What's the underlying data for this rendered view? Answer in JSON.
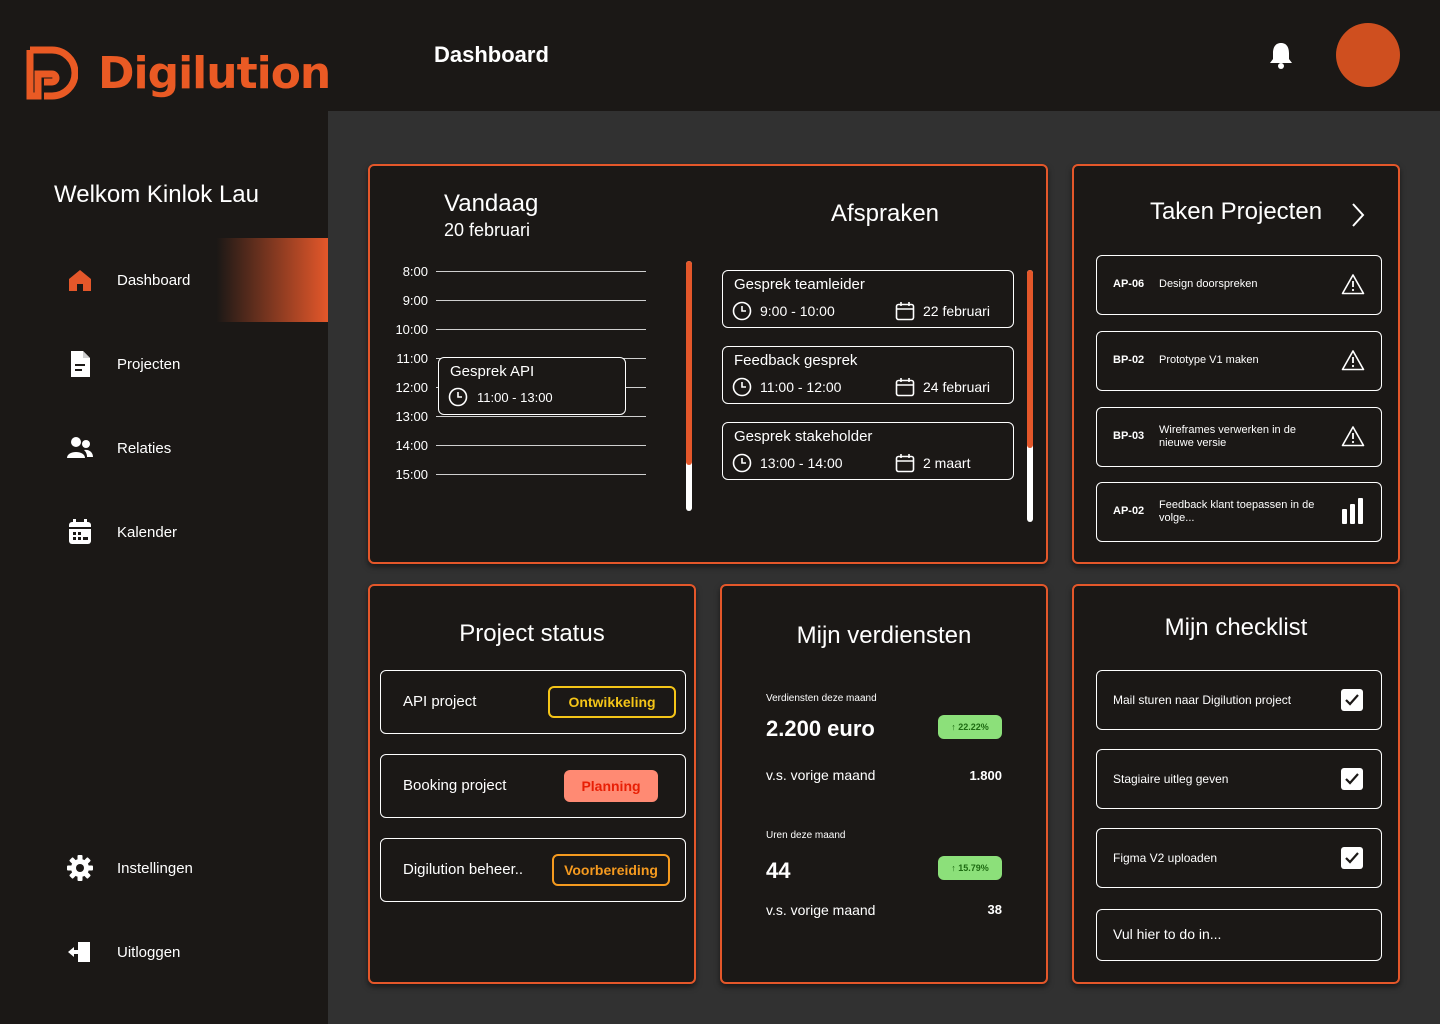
{
  "brand": {
    "name": "Digilution",
    "accent": "#e4572a",
    "logo_icon": "digilution-logo-icon"
  },
  "header": {
    "title": "Dashboard",
    "bell_icon": "bell-icon"
  },
  "sidebar": {
    "welcome": "Welkom Kinlok Lau",
    "items": [
      {
        "label": "Dashboard",
        "icon": "home-icon",
        "active": true
      },
      {
        "label": "Projecten",
        "icon": "document-icon"
      },
      {
        "label": "Relaties",
        "icon": "users-icon"
      },
      {
        "label": "Kalender",
        "icon": "calendar-icon"
      }
    ],
    "bottom": [
      {
        "label": "Instellingen",
        "icon": "gear-icon"
      },
      {
        "label": "Uitloggen",
        "icon": "logout-icon"
      }
    ]
  },
  "today": {
    "title": "Vandaag",
    "date": "20 februari",
    "hours": [
      "8:00",
      "9:00",
      "10:00",
      "11:00",
      "12:00",
      "13:00",
      "14:00",
      "15:00"
    ],
    "event": {
      "title": "Gesprek API",
      "time": "11:00 - 13:00"
    }
  },
  "appointments": {
    "title": "Afspraken",
    "items": [
      {
        "title": "Gesprek teamleider",
        "time": "9:00 - 10:00",
        "date": "22 februari"
      },
      {
        "title": "Feedback gesprek",
        "time": "11:00 - 12:00",
        "date": "24 februari"
      },
      {
        "title": "Gesprek stakeholder",
        "time": "13:00 - 14:00",
        "date": "2 maart"
      }
    ]
  },
  "tasks": {
    "title": "Taken Projecten",
    "items": [
      {
        "code": "AP-06",
        "desc": "Design doorspreken",
        "icon": "warning-icon"
      },
      {
        "code": "BP-02",
        "desc": "Prototype V1 maken",
        "icon": "warning-icon"
      },
      {
        "code": "BP-03",
        "desc": "Wireframes verwerken in de nieuwe versie",
        "icon": "warning-icon"
      },
      {
        "code": "AP-02",
        "desc": "Feedback klant toepassen in de volge...",
        "icon": "bar-chart-icon"
      }
    ]
  },
  "project_status": {
    "title": "Project status",
    "items": [
      {
        "name": "API project",
        "status": "Ontwikkeling",
        "color": "#f5c518"
      },
      {
        "name": "Booking project",
        "status": "Planning",
        "color": "#ff8a73"
      },
      {
        "name": "Digilution beheer..",
        "status": "Voorbereiding",
        "color": "#f59a1f"
      }
    ]
  },
  "earnings": {
    "title": "Mijn verdiensten",
    "month_label": "Verdiensten deze maand",
    "month_value": "2.200 euro",
    "month_change": "↑ 22.22%",
    "prev_label": "v.s. vorige maand",
    "prev_value": "1.800",
    "hours_label": "Uren deze maand",
    "hours_value": "44",
    "hours_change": "↑ 15.79%",
    "hours_prev_label": "v.s. vorige maand",
    "hours_prev_value": "38"
  },
  "checklist": {
    "title": "Mijn checklist",
    "items": [
      {
        "text": "Mail sturen naar Digilution project",
        "checked": true
      },
      {
        "text": "Stagiaire uitleg geven",
        "checked": true
      },
      {
        "text": "Figma V2 uploaden",
        "checked": true
      }
    ],
    "input_placeholder": "Vul hier to do in..."
  }
}
